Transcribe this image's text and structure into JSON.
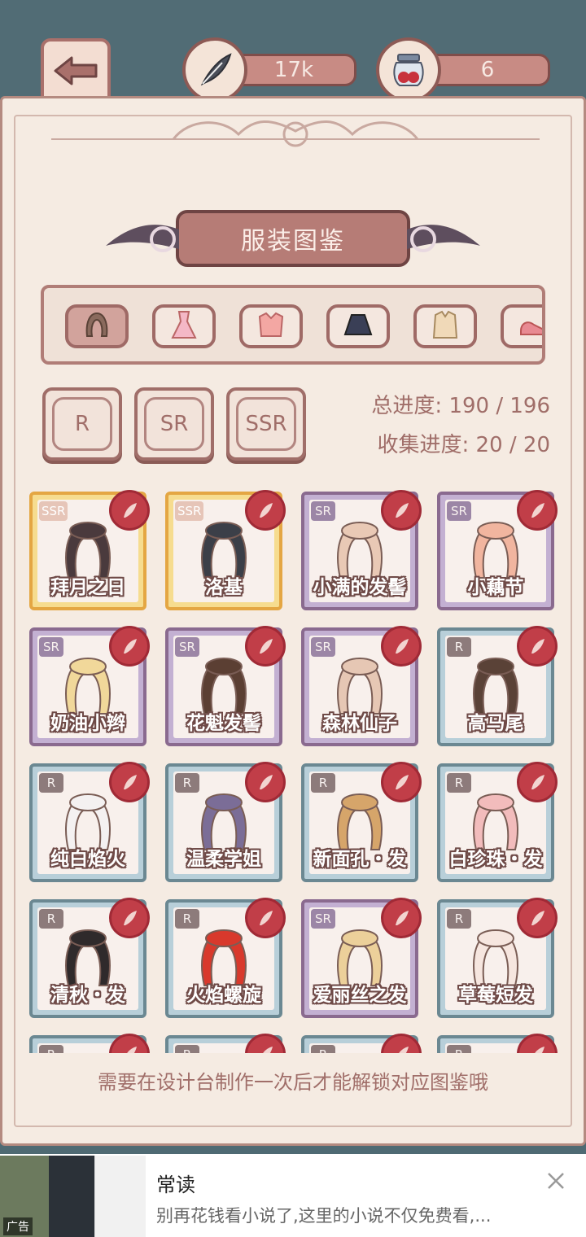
{
  "header": {
    "back_icon": "arrow-left-icon",
    "feather_icon": "feather-icon",
    "feather_count": "17k",
    "jar_icon": "jam-jar-icon",
    "jar_count": "6"
  },
  "title": "服装图鉴",
  "tabs": [
    {
      "icon": "hair-icon",
      "active": true
    },
    {
      "icon": "dress-icon",
      "active": false
    },
    {
      "icon": "top-icon",
      "active": false
    },
    {
      "icon": "skirt-icon",
      "active": false
    },
    {
      "icon": "jacket-icon",
      "active": false
    },
    {
      "icon": "shoe-icon",
      "active": false
    }
  ],
  "rarity_filters": [
    "R",
    "SR",
    "SSR"
  ],
  "progress": {
    "total": "总进度: 190 / 196",
    "collect": "收集进度: 20 / 20"
  },
  "cards": [
    {
      "rank": "SSR",
      "name": "拜月之日",
      "hair_color": "#4a3a3d"
    },
    {
      "rank": "SSR",
      "name": "洛基",
      "hair_color": "#3b3f48"
    },
    {
      "rank": "SR",
      "name": "小满的发髻",
      "hair_color": "#e9c9b5"
    },
    {
      "rank": "SR",
      "name": "小藕节",
      "hair_color": "#f1b59f"
    },
    {
      "rank": "SR",
      "name": "奶油小辫",
      "hair_color": "#f1d89a"
    },
    {
      "rank": "SR",
      "name": "花魁发髻",
      "hair_color": "#5b3f33"
    },
    {
      "rank": "SR",
      "name": "森林仙子",
      "hair_color": "#e6c7b4"
    },
    {
      "rank": "R",
      "name": "高马尾",
      "hair_color": "#5a4237"
    },
    {
      "rank": "R",
      "name": "纯白焰火",
      "hair_color": "#f4f1f1"
    },
    {
      "rank": "R",
      "name": "温柔学姐",
      "hair_color": "#7b6d97"
    },
    {
      "rank": "R",
      "name": "新面孔・发",
      "hair_color": "#d6a56a"
    },
    {
      "rank": "R",
      "name": "白珍珠・发",
      "hair_color": "#f2bcbc"
    },
    {
      "rank": "R",
      "name": "清秋・发",
      "hair_color": "#2f2a2b"
    },
    {
      "rank": "R",
      "name": "火焰螺旋",
      "hair_color": "#d8392c"
    },
    {
      "rank": "SR",
      "name": "爱丽丝之发",
      "hair_color": "#ecd09a"
    },
    {
      "rank": "R",
      "name": "草莓短发",
      "hair_color": "#f6e6df"
    },
    {
      "rank": "R",
      "name": "",
      "hair_color": "#cccccc"
    },
    {
      "rank": "R",
      "name": "",
      "hair_color": "#cccccc"
    },
    {
      "rank": "R",
      "name": "",
      "hair_color": "#cccccc"
    },
    {
      "rank": "R",
      "name": "",
      "hair_color": "#cccccc"
    }
  ],
  "hint": "需要在设计台制作一次后才能解锁对应图鉴哦",
  "ad": {
    "tag": "广告",
    "title": "常读",
    "desc": "别再花钱看小说了,这里的小说不仅免费看,...",
    "close_icon": "close-icon"
  },
  "colors": {
    "accent": "#a06e69",
    "panel": "#f5ebe2",
    "seal": "#c13e48"
  }
}
